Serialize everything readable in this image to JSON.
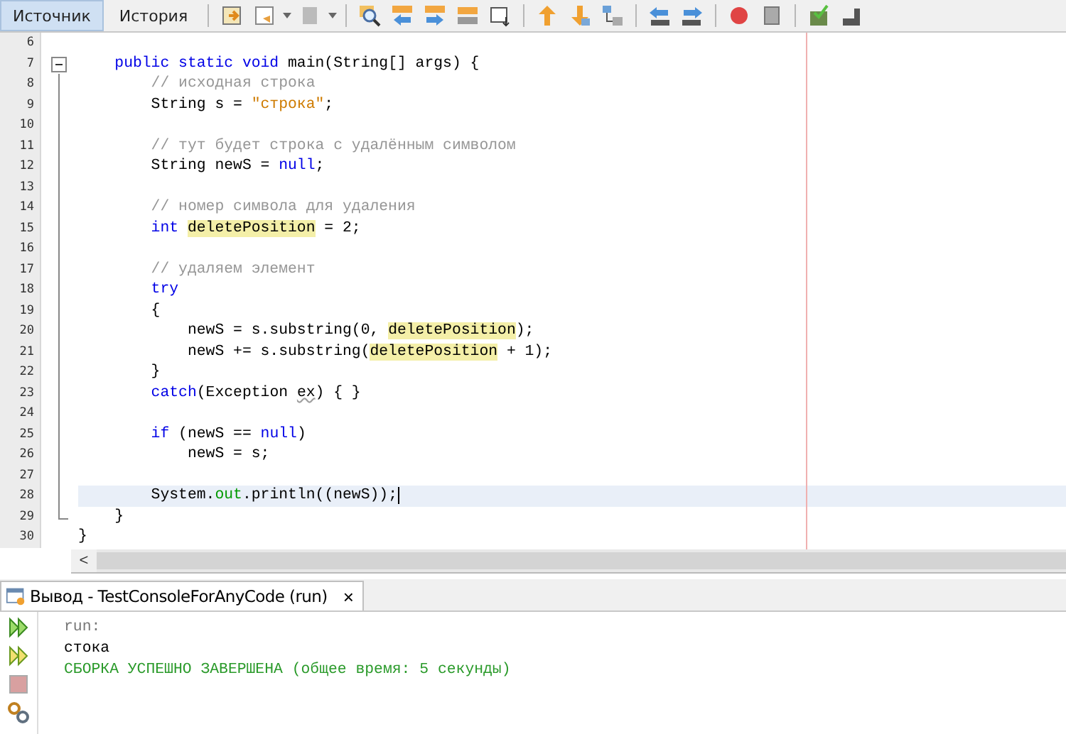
{
  "editor_tabs": [
    {
      "label": "Источник",
      "selected": true
    },
    {
      "label": "История",
      "selected": false
    }
  ],
  "code_lines": [
    {
      "number": "6",
      "kind": "plain",
      "current": false
    },
    {
      "number": "7",
      "kind": "fold_start",
      "current": false,
      "tokens": [
        {
          "text": "    public static void ",
          "kind": "keyword"
        },
        {
          "text": "main(String[] args) {",
          "kind": "plain"
        }
      ]
    },
    {
      "number": "8",
      "kind": "fold_inside",
      "current": false,
      "tokens": [
        {
          "text": "        // исходная строка",
          "kind": "comment"
        }
      ]
    },
    {
      "number": "9",
      "kind": "fold_inside",
      "current": false,
      "tokens": [
        {
          "text": "        String s = ",
          "kind": "plain"
        },
        {
          "text": "\"строка\"",
          "kind": "string"
        },
        {
          "text": ";",
          "kind": "plain"
        }
      ]
    },
    {
      "number": "10",
      "kind": "fold_inside",
      "current": false
    },
    {
      "number": "11",
      "kind": "fold_inside",
      "current": false,
      "tokens": [
        {
          "text": "        // тут будет строка с удалённым символом",
          "kind": "comment"
        }
      ]
    },
    {
      "number": "12",
      "kind": "fold_inside",
      "current": false,
      "tokens": [
        {
          "text": "        String newS = ",
          "kind": "plain"
        },
        {
          "text": "null",
          "kind": "keyword"
        },
        {
          "text": ";",
          "kind": "plain"
        }
      ]
    },
    {
      "number": "13",
      "kind": "fold_inside",
      "current": false
    },
    {
      "number": "14",
      "kind": "fold_inside",
      "current": false,
      "tokens": [
        {
          "text": "        // номер символа для удаления",
          "kind": "comment"
        }
      ]
    },
    {
      "number": "15",
      "kind": "fold_inside",
      "current": false,
      "tokens": [
        {
          "text": "        int ",
          "kind": "keyword"
        },
        {
          "text": "deletePosition",
          "kind": "highlight"
        },
        {
          "text": " = 2;",
          "kind": "plain"
        }
      ]
    },
    {
      "number": "16",
      "kind": "fold_inside",
      "current": false
    },
    {
      "number": "17",
      "kind": "fold_inside",
      "current": false,
      "tokens": [
        {
          "text": "        // удаляем элемент",
          "kind": "comment"
        }
      ]
    },
    {
      "number": "18",
      "kind": "fold_inside",
      "current": false,
      "tokens": [
        {
          "text": "        try",
          "kind": "keyword"
        }
      ]
    },
    {
      "number": "19",
      "kind": "fold_inside",
      "current": false,
      "tokens": [
        {
          "text": "        {",
          "kind": "plain"
        }
      ]
    },
    {
      "number": "20",
      "kind": "fold_inside",
      "current": false,
      "tokens": [
        {
          "text": "            newS = s.substring(0, ",
          "kind": "plain"
        },
        {
          "text": "deletePosition",
          "kind": "highlight"
        },
        {
          "text": ");",
          "kind": "plain"
        }
      ]
    },
    {
      "number": "21",
      "kind": "fold_inside",
      "current": false,
      "tokens": [
        {
          "text": "            newS += s.substring(",
          "kind": "plain"
        },
        {
          "text": "deletePosition",
          "kind": "highlight"
        },
        {
          "text": " + 1);",
          "kind": "plain"
        }
      ]
    },
    {
      "number": "22",
      "kind": "fold_inside",
      "current": false,
      "tokens": [
        {
          "text": "        }",
          "kind": "plain"
        }
      ]
    },
    {
      "number": "23",
      "kind": "fold_inside",
      "current": false,
      "tokens": [
        {
          "text": "        catch",
          "kind": "keyword"
        },
        {
          "text": "(Exception ",
          "kind": "plain"
        },
        {
          "text": "ex",
          "kind": "warning"
        },
        {
          "text": ") { }",
          "kind": "plain"
        }
      ]
    },
    {
      "number": "24",
      "kind": "fold_inside",
      "current": false
    },
    {
      "number": "25",
      "kind": "fold_inside",
      "current": false,
      "tokens": [
        {
          "text": "        if",
          "kind": "keyword"
        },
        {
          "text": " (newS == ",
          "kind": "plain"
        },
        {
          "text": "null",
          "kind": "keyword"
        },
        {
          "text": ")",
          "kind": "plain"
        }
      ]
    },
    {
      "number": "26",
      "kind": "fold_inside",
      "current": false,
      "tokens": [
        {
          "text": "            newS = s;",
          "kind": "plain"
        }
      ]
    },
    {
      "number": "27",
      "kind": "fold_inside",
      "current": false
    },
    {
      "number": "28",
      "kind": "fold_inside",
      "current": true,
      "tokens": [
        {
          "text": "        System.",
          "kind": "plain"
        },
        {
          "text": "out",
          "kind": "field"
        },
        {
          "text": ".println((newS));",
          "kind": "plain"
        }
      ]
    },
    {
      "number": "29",
      "kind": "fold_end",
      "current": false,
      "tokens": [
        {
          "text": "    }",
          "kind": "plain"
        }
      ]
    },
    {
      "number": "30",
      "kind": "plain",
      "current": false,
      "tokens": [
        {
          "text": "}",
          "kind": "plain"
        }
      ]
    }
  ],
  "scroll_left": "<",
  "output": {
    "title": "Вывод - TestConsoleForAnyCode (run)",
    "close": "×",
    "lines": [
      {
        "text": "run:",
        "kind": "info"
      },
      {
        "text": "стока",
        "kind": "plain"
      },
      {
        "text": "СБОРКА УСПЕШНО ЗАВЕРШЕНА (общее время: 5 секунды)",
        "kind": "success"
      }
    ]
  }
}
